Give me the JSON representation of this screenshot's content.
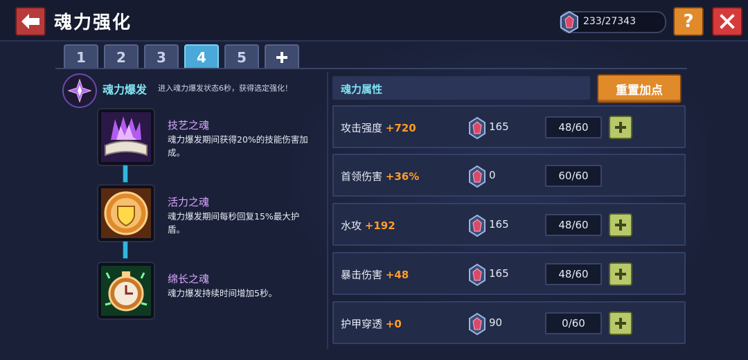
{
  "header": {
    "title": "魂力强化",
    "currency": "233/27343"
  },
  "tabs": [
    {
      "label": "1",
      "active": false
    },
    {
      "label": "2",
      "active": false
    },
    {
      "label": "3",
      "active": false
    },
    {
      "label": "4",
      "active": true
    },
    {
      "label": "5",
      "active": false
    }
  ],
  "burst": {
    "name": "魂力爆发",
    "desc": "进入魂力爆发状态6秒，获得选定强化！"
  },
  "skills": [
    {
      "name": "技艺之魂",
      "desc": "魂力爆发期间获得20%的技能伤害加成。",
      "icon": "purple-flame-book-icon"
    },
    {
      "name": "活力之魂",
      "desc": "魂力爆发期间每秒回复15%最大护盾。",
      "icon": "gold-shield-icon"
    },
    {
      "name": "绵长之魂",
      "desc": "魂力爆发持续时间增加5秒。",
      "icon": "green-stopwatch-icon"
    }
  ],
  "attributes": {
    "header": "魂力属性",
    "reset_label": "重置加点",
    "rows": [
      {
        "label": "攻击强度",
        "bonus": "+720",
        "cost": "165",
        "level": "48/60",
        "has_plus": true
      },
      {
        "label": "首领伤害",
        "bonus": "+36%",
        "cost": "0",
        "level": "60/60",
        "has_plus": false
      },
      {
        "label": "水攻",
        "bonus": "+192",
        "cost": "165",
        "level": "48/60",
        "has_plus": true
      },
      {
        "label": "暴击伤害",
        "bonus": "+48",
        "cost": "165",
        "level": "48/60",
        "has_plus": true
      },
      {
        "label": "护甲穿透",
        "bonus": "+0",
        "cost": "90",
        "level": "0/60",
        "has_plus": true
      }
    ]
  },
  "colors": {
    "accent_cyan": "#7fe3f0",
    "bonus_orange": "#ff9c2a",
    "tab_active": "#4aa9d8",
    "skill_name_purple": "#d9a6ff"
  }
}
